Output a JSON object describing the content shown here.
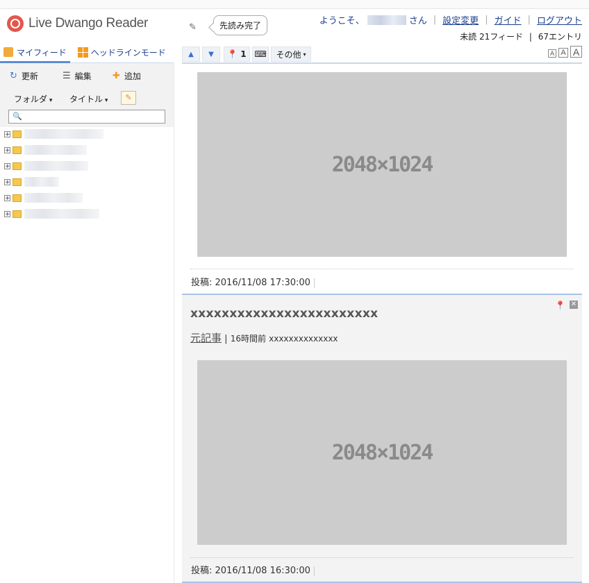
{
  "app": {
    "title": "Live Dwango Reader"
  },
  "header": {
    "notification": "先読み完了",
    "welcome_prefix": "ようこそ、",
    "welcome_suffix": "さん",
    "links": {
      "settings": "設定変更",
      "guide": "ガイド",
      "logout": "ログアウト"
    },
    "unread_feeds": "未読 21フィード",
    "sep": "|",
    "unread_entries": "67エントリ"
  },
  "tabs": {
    "my_feed": "マイフィード",
    "headline_mode": "ヘッドラインモード"
  },
  "sidebar_tools": {
    "refresh": "更新",
    "edit": "編集",
    "add": "追加",
    "folder": "フォルダ",
    "title": "タイトル"
  },
  "sidebar": {
    "folder_count": 6
  },
  "toolbar": {
    "pin_count": "1",
    "more": "その他"
  },
  "font_size": {
    "small": "A",
    "medium": "A",
    "large": "A"
  },
  "entries": [
    {
      "image_label": "2048×1024",
      "posted": "投稿: 2016/11/08 17:30:00"
    },
    {
      "title": "xxxxxxxxxxxxxxxxxxxxxxxx",
      "source_link": "元記事",
      "separator": "|",
      "age": "16時間前",
      "author": "xxxxxxxxxxxxxx",
      "image_label": "2048×1024",
      "posted": "投稿: 2016/11/08 16:30:00"
    }
  ]
}
